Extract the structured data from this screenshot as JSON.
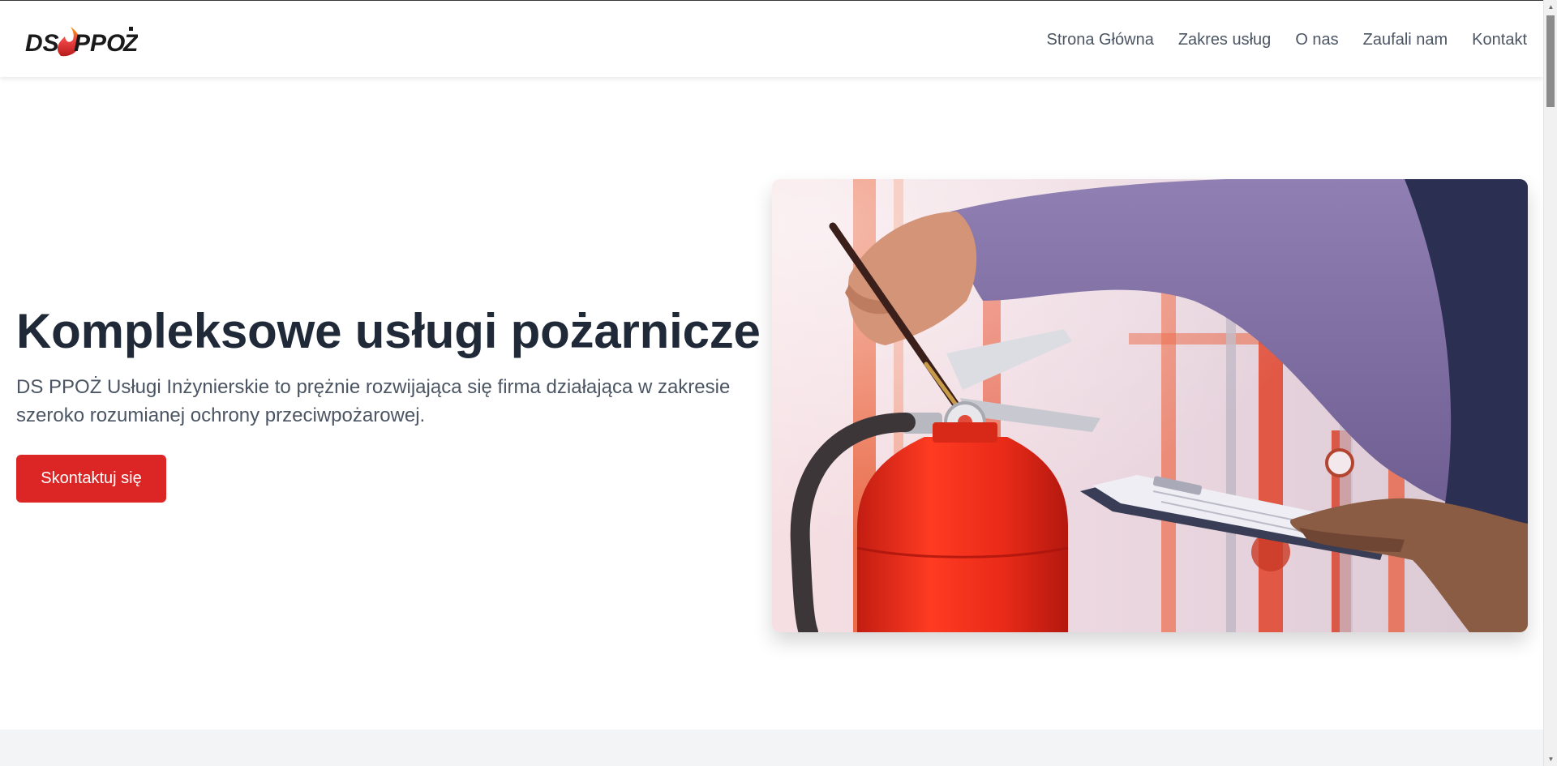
{
  "brand": {
    "logo_text": "DS PPOŻ",
    "colors": {
      "accent": "#dc2626",
      "text_dark": "#1f2937",
      "text_muted": "#4b5563"
    }
  },
  "nav": {
    "items": [
      {
        "label": "Strona Główna"
      },
      {
        "label": "Zakres usług"
      },
      {
        "label": "O nas"
      },
      {
        "label": "Zaufali nam"
      },
      {
        "label": "Kontakt"
      }
    ]
  },
  "hero": {
    "title": "Kompleksowe usługi pożarnicze",
    "description": "DS PPOŻ Usługi Inżynierskie to prężnie rozwijająca się firma działająca w zakresie szeroko rozumianej ochrony przeciwpożarowej.",
    "cta_label": "Skontaktuj się",
    "image_subject": "fire-extinguisher-inspection-photo"
  }
}
